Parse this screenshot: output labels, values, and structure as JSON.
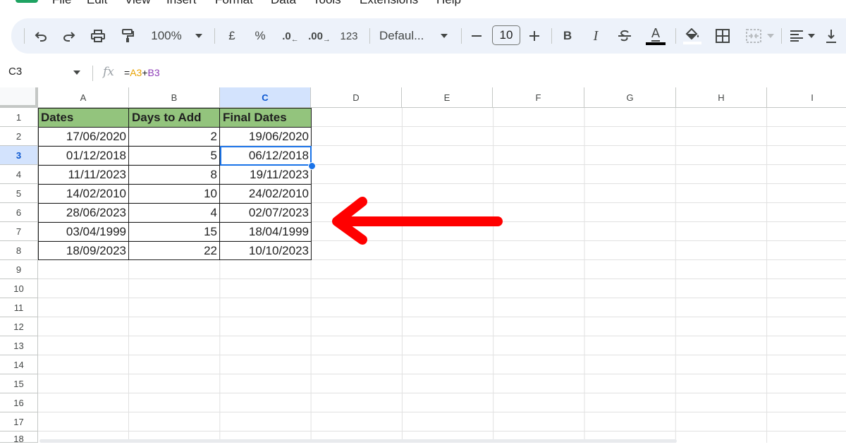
{
  "menu": [
    "File",
    "Edit",
    "View",
    "Insert",
    "Format",
    "Data",
    "Tools",
    "Extensions",
    "Help"
  ],
  "toolbar": {
    "zoom": "100%",
    "currency": "£",
    "percent": "%",
    "dec_decrease": ".0",
    "dec_increase": ".00",
    "number_format": "123",
    "font": "Defaul...",
    "font_size": "10",
    "bold": "B",
    "italic": "I",
    "text_color_letter": "A"
  },
  "formula_bar": {
    "cell_ref": "C3",
    "fx": "fx",
    "formula_eq": "=",
    "formula_ref1": "A3",
    "formula_op": "+",
    "formula_ref2": "B3"
  },
  "sheet": {
    "columns": [
      "A",
      "B",
      "C",
      "D",
      "E",
      "F",
      "G",
      "H",
      "I"
    ],
    "rows": [
      "1",
      "2",
      "3",
      "4",
      "5",
      "6",
      "7",
      "8",
      "9",
      "10",
      "11",
      "12",
      "13",
      "14",
      "15",
      "16",
      "17",
      "18"
    ],
    "selected_cell": "C3",
    "headers": [
      "Dates",
      "Days to Add",
      "Final Dates"
    ],
    "data": [
      [
        "17/06/2020",
        "2",
        "19/06/2020"
      ],
      [
        "01/12/2018",
        "5",
        "06/12/2018"
      ],
      [
        "11/11/2023",
        "8",
        "19/11/2023"
      ],
      [
        "14/02/2010",
        "10",
        "24/02/2010"
      ],
      [
        "28/06/2023",
        "4",
        "02/07/2023"
      ],
      [
        "03/04/1999",
        "15",
        "18/04/1999"
      ],
      [
        "18/09/2023",
        "22",
        "10/10/2023"
      ]
    ]
  },
  "colors": {
    "header_fill": "#93c47d",
    "selection": "#1a73e8",
    "annotation_arrow": "#ff0000"
  }
}
